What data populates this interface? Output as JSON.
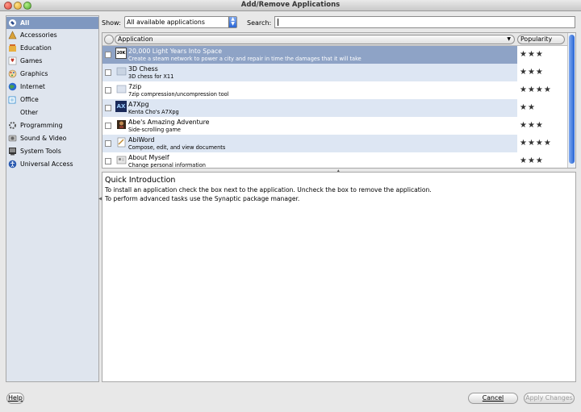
{
  "window": {
    "title": "Add/Remove Applications"
  },
  "sidebar": {
    "items": [
      {
        "label": "All",
        "icon": "all-icon",
        "color": "#2a4b8c"
      },
      {
        "label": "Accessories",
        "icon": "accessories-icon",
        "color": "#c08a30"
      },
      {
        "label": "Education",
        "icon": "education-icon",
        "color": "#d06a2a"
      },
      {
        "label": "Games",
        "icon": "games-icon",
        "color": "#c0392b"
      },
      {
        "label": "Graphics",
        "icon": "graphics-icon",
        "color": "#c0392b"
      },
      {
        "label": "Internet",
        "icon": "internet-icon",
        "color": "#2a6ad0"
      },
      {
        "label": "Office",
        "icon": "office-icon",
        "color": "#2a8ad0"
      },
      {
        "label": "Other",
        "icon": "other-icon",
        "color": "#8a8a8a"
      },
      {
        "label": "Programming",
        "icon": "programming-icon",
        "color": "#5a5a5a"
      },
      {
        "label": "Sound & Video",
        "icon": "sound-video-icon",
        "color": "#6a6a6a"
      },
      {
        "label": "System Tools",
        "icon": "system-tools-icon",
        "color": "#4a4a4a"
      },
      {
        "label": "Universal Access",
        "icon": "universal-access-icon",
        "color": "#2a5ab0"
      }
    ]
  },
  "filter": {
    "show_label": "Show:",
    "show_value": "All available applications"
  },
  "search": {
    "label": "Search:",
    "value": ""
  },
  "list": {
    "col_application": "Application",
    "col_popularity": "Popularity",
    "rows": [
      {
        "name": "20,000 Light Years Into Space",
        "desc": "Create a steam network to power a city and repair in time the damages that it will take",
        "stars": "★★★",
        "icon_text": "20K"
      },
      {
        "name": "3D Chess",
        "desc": "3D chess for X11",
        "stars": "★★★",
        "icon_text": ""
      },
      {
        "name": "7zip",
        "desc": "7zip compression/uncompression tool",
        "stars": "★★★★",
        "icon_text": ""
      },
      {
        "name": "A7Xpg",
        "desc": "Kenta Cho's A7Xpg",
        "stars": "★★",
        "icon_text": "AX"
      },
      {
        "name": "Abe's Amazing Adventure",
        "desc": "Side-scrolling game",
        "stars": "★★★",
        "icon_text": ""
      },
      {
        "name": "AbiWord",
        "desc": "Compose, edit, and view documents",
        "stars": "★★★★",
        "icon_text": ""
      },
      {
        "name": "About Myself",
        "desc": "Change personal information",
        "stars": "★★★",
        "icon_text": ""
      }
    ]
  },
  "info": {
    "heading": "Quick Introduction",
    "line1": "To install an application check the box next to the application. Uncheck the box to remove the application.",
    "line2": "To perform advanced tasks use the Synaptic package manager."
  },
  "buttons": {
    "help": "Help",
    "cancel": "Cancel",
    "apply": "Apply Changes"
  }
}
